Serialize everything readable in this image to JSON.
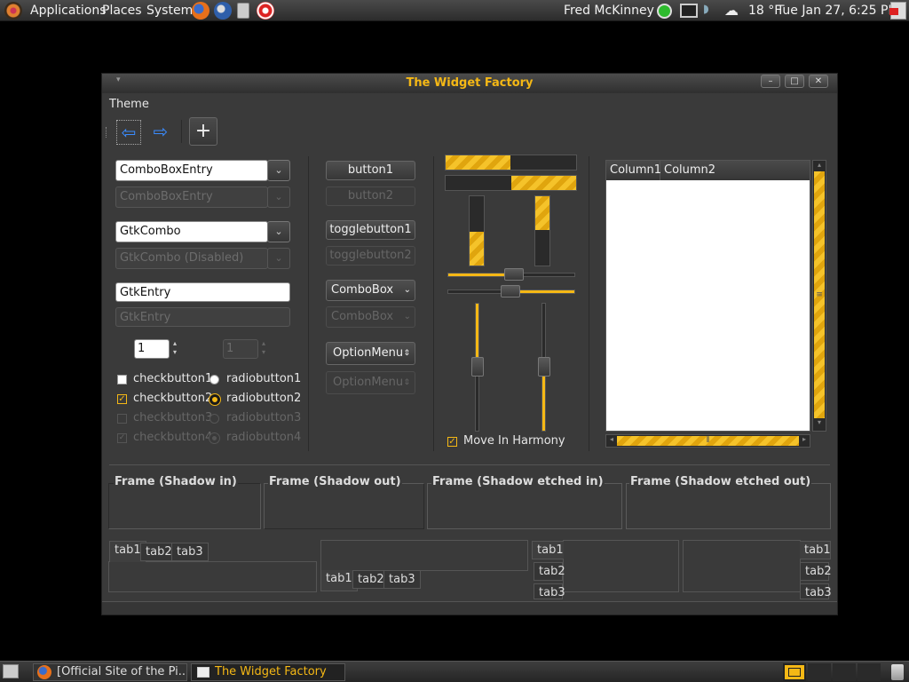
{
  "panel": {
    "menu": [
      "Applications",
      "Places",
      "System"
    ],
    "user": "Fred McKinney",
    "temperature": "18 °F",
    "datetime": "Tue Jan 27,  6:25 PM"
  },
  "taskbar": {
    "tasks": [
      "[Official Site of the Pi...",
      "The Widget Factory"
    ]
  },
  "window": {
    "title": "The Widget Factory",
    "menu": "Theme"
  },
  "col1": {
    "combo_entry": "ComboBoxEntry",
    "combo_entry_dis": "ComboBoxEntry",
    "gtkcombo": "GtkCombo",
    "gtkcombo_dis": "GtkCombo (Disabled)",
    "entry": "GtkEntry",
    "entry_dis": "GtkEntry",
    "spin": "1",
    "spin_dis": "1",
    "checks": [
      "checkbutton1",
      "checkbutton2",
      "checkbutton3",
      "checkbutton4"
    ],
    "radios": [
      "radiobutton1",
      "radiobutton2",
      "radiobutton3",
      "radiobutton4"
    ]
  },
  "col2": {
    "button1": "button1",
    "button2": "button2",
    "toggle1": "togglebutton1",
    "toggle2": "togglebutton2",
    "combobox": "ComboBox",
    "combobox_dis": "ComboBox",
    "option": "OptionMenu",
    "option_dis": "OptionMenu"
  },
  "col3": {
    "harmony": "Move In Harmony"
  },
  "tree": {
    "columns": [
      "Column1",
      "Column2"
    ]
  },
  "frames": [
    "Frame (Shadow in)",
    "Frame (Shadow out)",
    "Frame (Shadow etched in)",
    "Frame (Shadow etched out)"
  ],
  "tabs": [
    "tab1",
    "tab2",
    "tab3"
  ],
  "colors": {
    "accent": "#f5b815",
    "bg": "#3a3a3a"
  },
  "icons": [
    "ubuntu-logo-icon",
    "firefox-icon",
    "thunderbird-icon",
    "notes-icon",
    "help-icon",
    "network-icon",
    "display-icon",
    "volume-icon",
    "weather-icon",
    "logout-icon",
    "show-desktop-icon",
    "trash-icon",
    "back-arrow-icon",
    "forward-arrow-icon",
    "add-icon",
    "workspace-icon"
  ]
}
